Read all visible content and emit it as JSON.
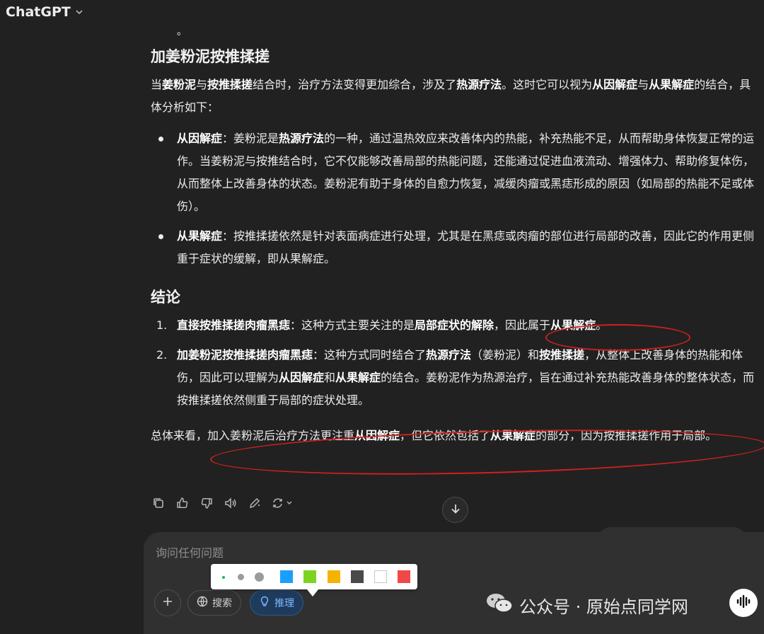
{
  "header": {
    "title": "ChatGPT"
  },
  "stub_text": "。",
  "section1": {
    "heading": "加姜粉泥按推揉搓",
    "intro": [
      {
        "t": "当",
        "b": false
      },
      {
        "t": "姜粉泥",
        "b": true
      },
      {
        "t": "与",
        "b": false
      },
      {
        "t": "按推揉搓",
        "b": true
      },
      {
        "t": "结合时，治疗方法变得更加综合，涉及了",
        "b": false
      },
      {
        "t": "热源疗法",
        "b": true
      },
      {
        "t": "。这时它可以视为",
        "b": false
      },
      {
        "t": "从因解症",
        "b": true
      },
      {
        "t": "与",
        "b": false
      },
      {
        "t": "从果解症",
        "b": true
      },
      {
        "t": "的结合，具体分析如下：",
        "b": false
      }
    ],
    "bullets": [
      [
        {
          "t": "从因解症",
          "b": true
        },
        {
          "t": "：姜粉泥是",
          "b": false
        },
        {
          "t": "热源疗法",
          "b": true
        },
        {
          "t": "的一种，通过温热效应来改善体内的热能，补充热能不足，从而帮助身体恢复正常的运作。当姜粉泥与按推结合时，它不仅能够改善局部的热能问题，还能通过促进血液流动、增强体力、帮助修复体伤，从而整体上改善身体的状态。姜粉泥有助于身体的自愈力恢复，减缓肉瘤或黑痣形成的原因（如局部的热能不足或体伤）。",
          "b": false
        }
      ],
      [
        {
          "t": "从果解症",
          "b": true
        },
        {
          "t": "：按推揉搓依然是针对表面病症进行处理，尤其是在黑痣或肉瘤的部位进行局部的改善，因此它的作用更侧重于症状的缓解，即从果解症。",
          "b": false
        }
      ]
    ]
  },
  "section2": {
    "heading": "结论",
    "items": [
      {
        "num": "1.",
        "parts": [
          {
            "t": "直接按推揉搓肉瘤黑痣",
            "b": true
          },
          {
            "t": "：这种方式主要关注的是",
            "b": false
          },
          {
            "t": "局部症状的解除",
            "b": true
          },
          {
            "t": "，因此属于",
            "b": false
          },
          {
            "t": "从果解症",
            "b": true
          },
          {
            "t": "。",
            "b": false
          }
        ]
      },
      {
        "num": "2.",
        "parts": [
          {
            "t": "加姜粉泥按推揉搓肉瘤黑痣",
            "b": true
          },
          {
            "t": "：这种方式同时结合了",
            "b": false
          },
          {
            "t": "热源疗法",
            "b": true
          },
          {
            "t": "（姜粉泥）和",
            "b": false
          },
          {
            "t": "按推揉搓",
            "b": true
          },
          {
            "t": "，从整体上改善身体的热能和体伤，因此可以理解为",
            "b": false
          },
          {
            "t": "从因解症",
            "b": true
          },
          {
            "t": "和",
            "b": false
          },
          {
            "t": "从果解症",
            "b": true
          },
          {
            "t": "的结合。姜粉泥作为热源治疗，旨在通过补充热能改善身体的整体状态，而按推揉搓依然侧重于局部的症状处理。",
            "b": false
          }
        ]
      }
    ]
  },
  "summary": [
    {
      "t": "总体来看，加入姜粉泥后治疗方法更注重",
      "b": false
    },
    {
      "t": "从因解症",
      "b": true
    },
    {
      "t": "，但它依然包括了",
      "b": false
    },
    {
      "t": "从果解症",
      "b": true
    },
    {
      "t": "的部分，因为按推揉搓作用于局部。",
      "b": false
    }
  ],
  "actions": [
    "copy-icon",
    "thumbs-up-icon",
    "thumbs-down-icon",
    "read-aloud-icon",
    "edit-icon",
    "regenerate-icon"
  ],
  "composer": {
    "placeholder": "询问任何问题",
    "search_label": "搜索",
    "reason_label": "推理"
  },
  "palette": {
    "colors": [
      "#1a9fff",
      "#7ed321",
      "#f5b301",
      "#4a4a4a",
      "#ffffff",
      "#f04848"
    ],
    "accent": "#1db954"
  },
  "watermark": "公众号 · 原始点同学网",
  "annotation_color": "#d0201e"
}
